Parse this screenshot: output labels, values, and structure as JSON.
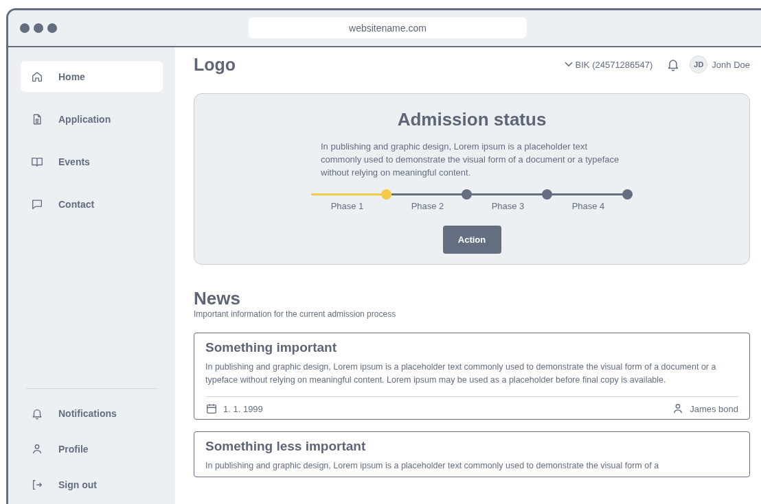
{
  "browser": {
    "url": "websitename.com"
  },
  "sidebar": {
    "items": [
      {
        "label": "Home",
        "selected": true
      },
      {
        "label": "Application",
        "selected": false
      },
      {
        "label": "Events",
        "selected": false
      },
      {
        "label": "Contact",
        "selected": false
      }
    ],
    "bottom_items": [
      {
        "label": "Notifications"
      },
      {
        "label": "Profile"
      },
      {
        "label": "Sign out"
      }
    ]
  },
  "header": {
    "logo": "Logo",
    "account": "BIK (24571286547)",
    "avatar": "JD",
    "user": "Jonh Doe"
  },
  "status_card": {
    "title": "Admission status",
    "text": "In publishing and graphic design, Lorem ipsum is a placeholder text commonly used to demonstrate the visual form of a document or a typeface without relying on meaningful content.",
    "phases": [
      {
        "label": "Phase 1",
        "done": true
      },
      {
        "label": "Phase 2",
        "done": false
      },
      {
        "label": "Phase 3",
        "done": false
      },
      {
        "label": "Phase 4",
        "done": false
      }
    ],
    "button": "Action"
  },
  "news": {
    "title": "News",
    "subtitle": "Important information for the current admission process",
    "items": [
      {
        "title": "Something important",
        "text": "In publishing and graphic design, Lorem ipsum is a placeholder text commonly used to demonstrate the visual form of a document or a typeface without relying on meaningful content. Lorem ipsum may be used as a placeholder before final copy is available.",
        "date": "1. 1. 1999",
        "author": "James bond"
      },
      {
        "title": "Something less important",
        "text": "In publishing and graphic design, Lorem ipsum is a placeholder text commonly used to demonstrate the visual form of a"
      }
    ]
  }
}
